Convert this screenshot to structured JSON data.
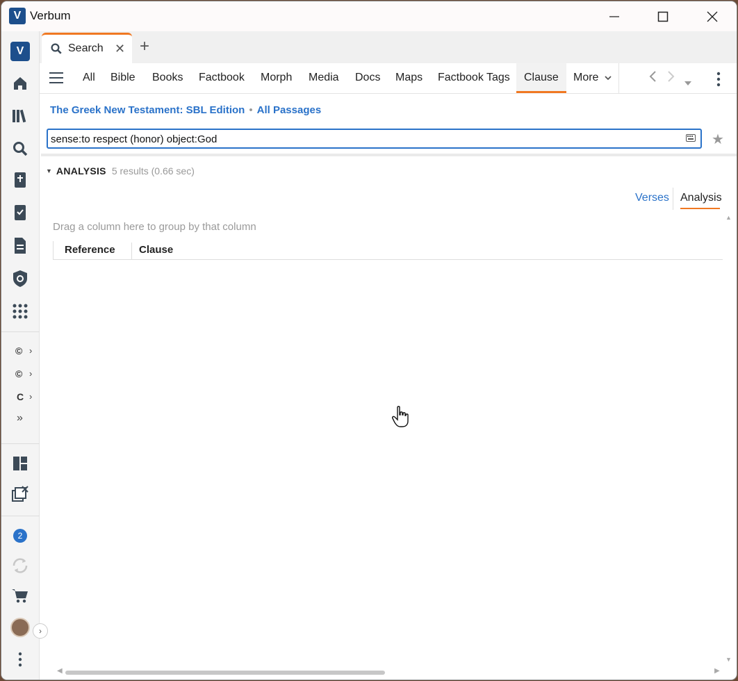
{
  "window": {
    "title": "Verbum",
    "minimize": "—",
    "maximize": "☐",
    "close": "✕"
  },
  "rail": {
    "items": [
      "verbum-logo",
      "home-icon",
      "library-icon",
      "search-icon",
      "bible-icon",
      "checklist-icon",
      "document-icon",
      "shield-icon",
      "apps-icon"
    ],
    "recent": [
      {
        "label": "©"
      },
      {
        "label": "©"
      },
      {
        "label": "C"
      }
    ],
    "badge_count": "2"
  },
  "tabs": {
    "search_label": "Search"
  },
  "nav": {
    "items": [
      "All",
      "Bible",
      "Books",
      "Factbook",
      "Morph",
      "Media",
      "Docs",
      "Maps",
      "Factbook Tags",
      "Clause",
      "More"
    ],
    "active": "Clause"
  },
  "search": {
    "resource": "The Greek New Testament: SBL Edition",
    "range": "All Passages",
    "query": "sense:to respect (honor) object:God"
  },
  "results": {
    "section_title": "ANALYSIS",
    "count_text": "5 results (0.66 sec)",
    "view_verses": "Verses",
    "view_analysis": "Analysis",
    "group_hint": "Drag a column here to group by that column",
    "columns": [
      "Reference",
      "Clause"
    ]
  },
  "colors": {
    "accent": "#f07822",
    "link": "#2a72c9",
    "brand": "#1d4f8c"
  }
}
